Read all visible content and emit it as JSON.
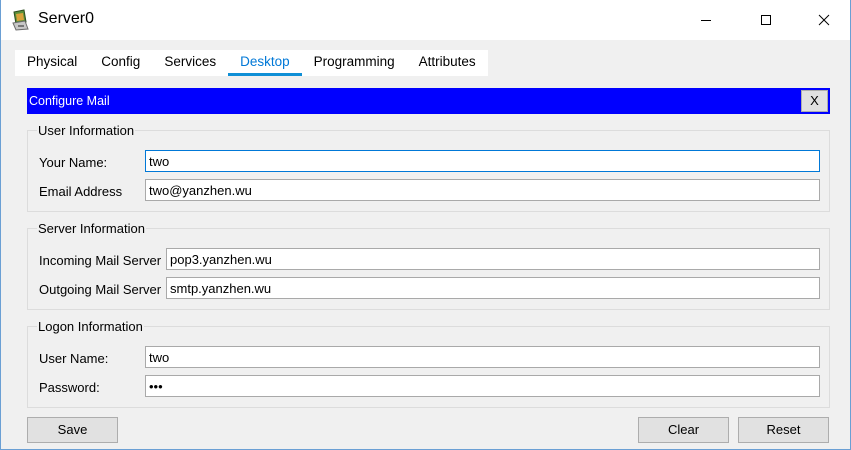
{
  "window": {
    "title": "Server0",
    "icon": "packet-tracer-server-icon",
    "controls": [
      "minimize-icon",
      "maximize-icon",
      "close-icon"
    ]
  },
  "tabs": [
    {
      "label": "Physical",
      "active": false
    },
    {
      "label": "Config",
      "active": false
    },
    {
      "label": "Services",
      "active": false
    },
    {
      "label": "Desktop",
      "active": true
    },
    {
      "label": "Programming",
      "active": false
    },
    {
      "label": "Attributes",
      "active": false
    }
  ],
  "mail": {
    "header_title": "Configure Mail",
    "close_label": "X",
    "user_info": {
      "legend": "User Information",
      "your_name_label": "Your Name:",
      "your_name_value": "two",
      "email_label": "Email Address",
      "email_value": "two@yanzhen.wu"
    },
    "server_info": {
      "legend": "Server Information",
      "incoming_label": "Incoming Mail Server",
      "incoming_value": "pop3.yanzhen.wu",
      "outgoing_label": "Outgoing Mail Server",
      "outgoing_value": "smtp.yanzhen.wu"
    },
    "logon_info": {
      "legend": "Logon Information",
      "username_label": "User Name:",
      "username_value": "two",
      "password_label": "Password:",
      "password_value": "two"
    },
    "buttons": {
      "save": "Save",
      "clear": "Clear",
      "reset": "Reset"
    }
  },
  "colors": {
    "header_blue": "#0000ff",
    "active_tab": "#0078d7",
    "panel_bg": "#f0f0f0"
  }
}
